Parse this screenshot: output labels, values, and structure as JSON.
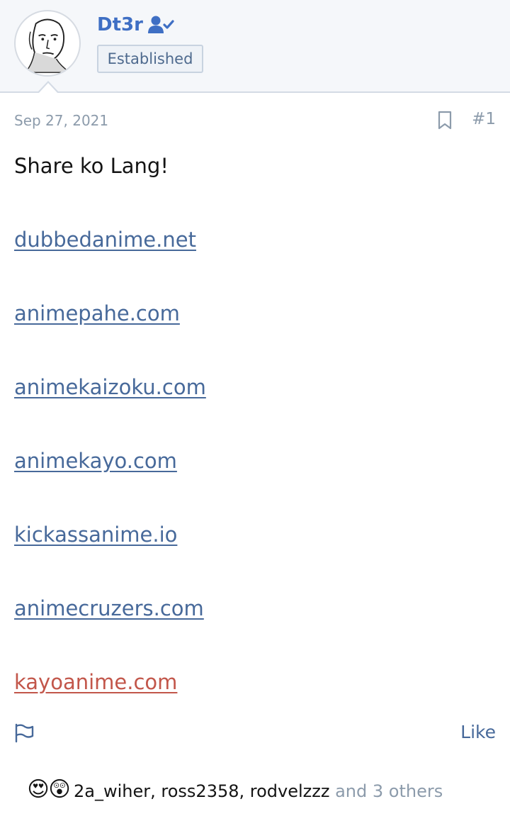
{
  "post": {
    "author": "Dt3r",
    "author_icon": "user-check-icon",
    "user_title": "Established",
    "date": "Sep 27, 2021",
    "post_number": "#1",
    "bookmark_icon": "bookmark-icon",
    "body_text": "Share ko Lang!",
    "links": [
      {
        "text": "dubbedanime.net",
        "visited": false
      },
      {
        "text": "animepahe.com",
        "visited": false
      },
      {
        "text": "animekaizoku.com",
        "visited": false
      },
      {
        "text": "animekayo.com",
        "visited": false
      },
      {
        "text": "kickassanime.io",
        "visited": false
      },
      {
        "text": "animecruzers.com",
        "visited": false
      },
      {
        "text": "kayoanime.com",
        "visited": true
      }
    ],
    "flag_icon": "flag-icon",
    "like_label": "Like"
  },
  "reactions": {
    "icons": [
      "heart-eyes-emoji",
      "astonished-emoji"
    ],
    "users": [
      "2a_wiher",
      "ross2358",
      "rodvelzzz"
    ],
    "separator": ", ",
    "others_text": " and 3 others"
  },
  "colors": {
    "accent": "#3f6fc4",
    "link": "#47699a",
    "visited_link": "#c2564a",
    "muted": "#8c9bab",
    "header_bg": "#f5f7fa"
  }
}
